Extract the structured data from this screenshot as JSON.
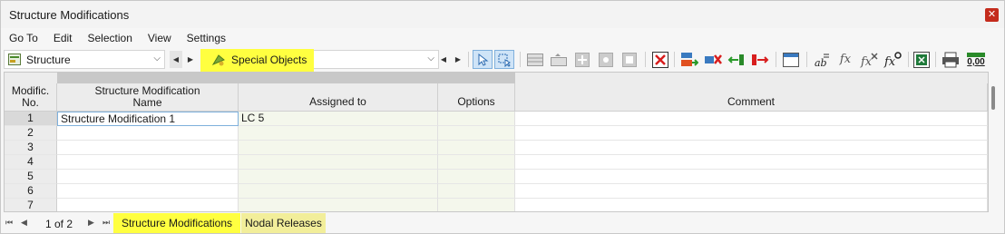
{
  "window": {
    "title": "Structure Modifications"
  },
  "menu": [
    "Go To",
    "Edit",
    "Selection",
    "View",
    "Settings"
  ],
  "toolbar": {
    "structure_combo": "Structure",
    "objects_combo": "Special Objects",
    "formula_text": "fx",
    "decimal_text": "0,00"
  },
  "columns": {
    "no_line1": "Modific.",
    "no_line2": "No.",
    "name_line1": "Structure Modification",
    "name_line2": "Name",
    "assigned": "Assigned to",
    "options": "Options",
    "comment": "Comment"
  },
  "rows": [
    {
      "no": "1",
      "name": "Structure Modification 1",
      "assigned": "LC 5",
      "options": "",
      "comment": ""
    },
    {
      "no": "2",
      "name": "",
      "assigned": "",
      "options": "",
      "comment": ""
    },
    {
      "no": "3",
      "name": "",
      "assigned": "",
      "options": "",
      "comment": ""
    },
    {
      "no": "4",
      "name": "",
      "assigned": "",
      "options": "",
      "comment": ""
    },
    {
      "no": "5",
      "name": "",
      "assigned": "",
      "options": "",
      "comment": ""
    },
    {
      "no": "6",
      "name": "",
      "assigned": "",
      "options": "",
      "comment": ""
    },
    {
      "no": "7",
      "name": "",
      "assigned": "",
      "options": "",
      "comment": ""
    }
  ],
  "pagination": {
    "label": "1 of 2"
  },
  "tabs": [
    "Structure Modifications",
    "Nodal Releases"
  ],
  "colors": {
    "highlight": "#ffff40",
    "close": "#c42b1c",
    "active_tool": "#cfe4f7"
  }
}
